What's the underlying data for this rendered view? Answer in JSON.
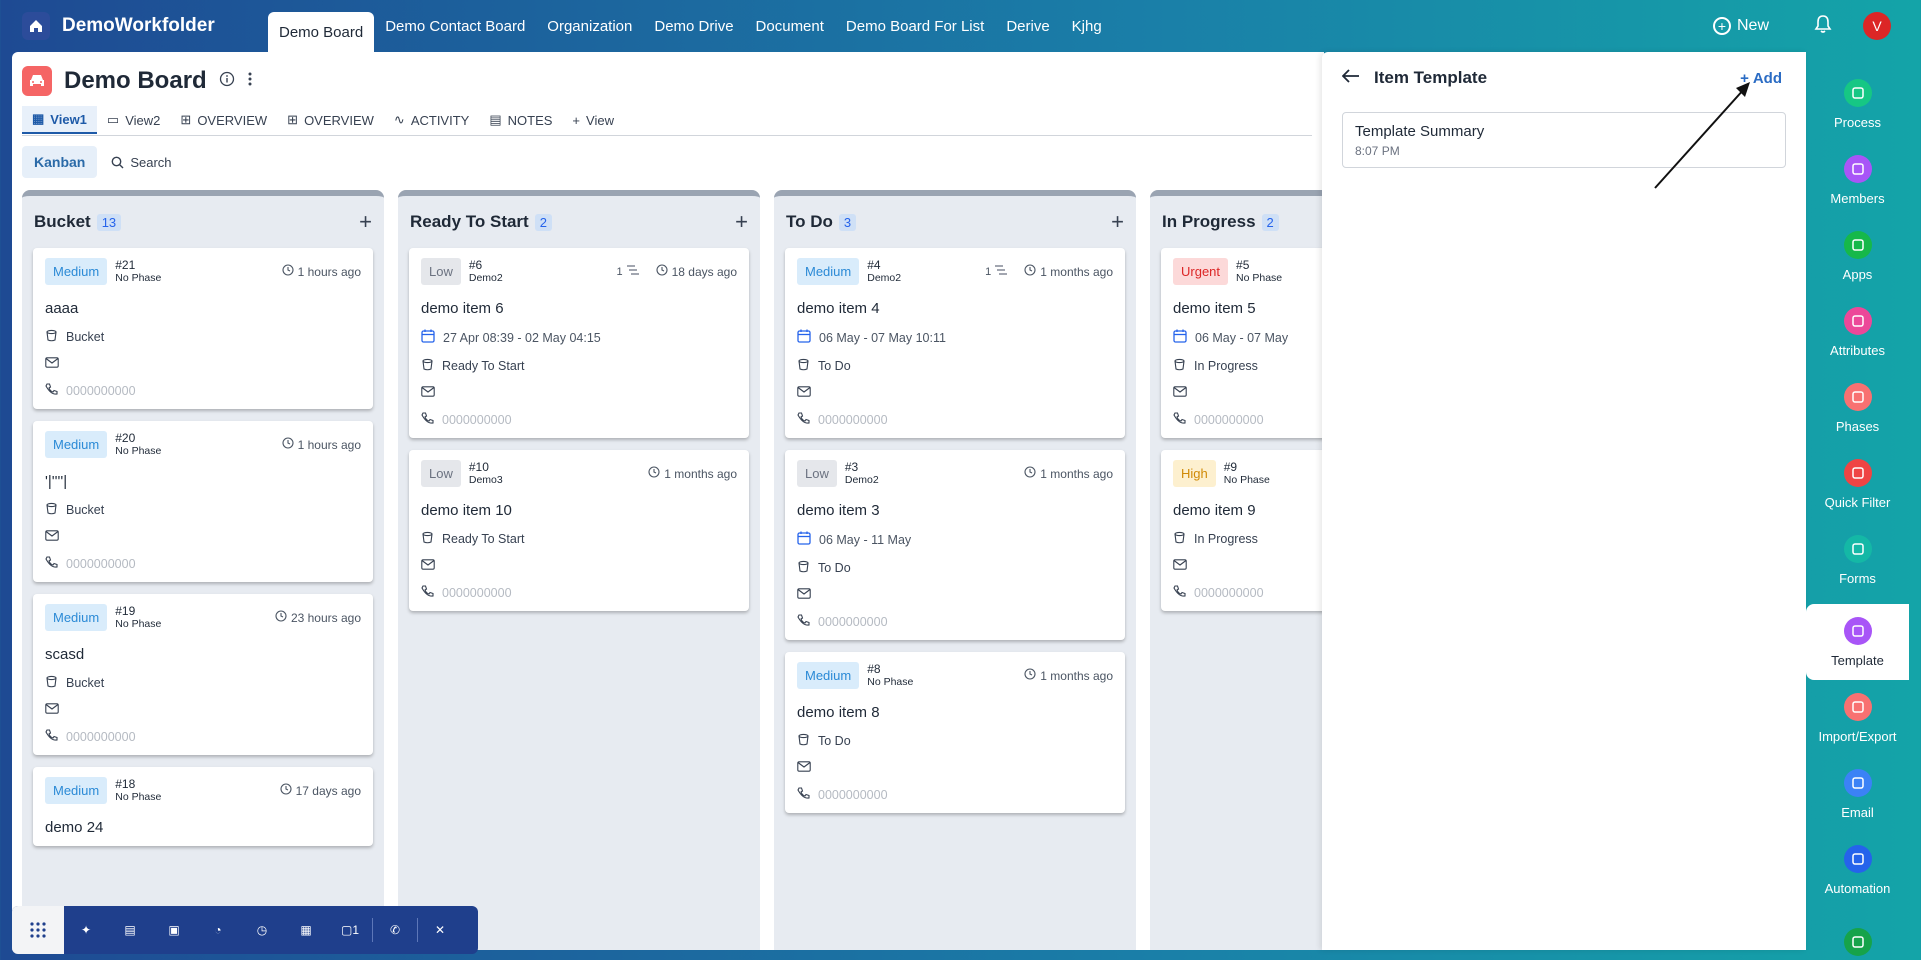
{
  "app": {
    "brand": "DemoWorkfolder",
    "nav_tabs": [
      "Demo Board",
      "Demo Contact Board",
      "Organization",
      "Demo Drive",
      "Document",
      "Demo Board For List",
      "Derive",
      "Kjhg"
    ],
    "new_label": "New",
    "avatar_initial": "V"
  },
  "board": {
    "title": "Demo Board",
    "view_tabs": [
      "View1",
      "View2",
      "OVERVIEW",
      "OVERVIEW",
      "ACTIVITY",
      "NOTES",
      "View"
    ],
    "kanban_label": "Kanban",
    "search_label": "Search"
  },
  "columns": [
    {
      "title": "Bucket",
      "count": "13",
      "cards": [
        {
          "priority": "Medium",
          "number": "#21",
          "phase": "No Phase",
          "time": "1 hours ago",
          "title": "aaaa",
          "bucket": "Bucket",
          "phone": "0000000000"
        },
        {
          "priority": "Medium",
          "number": "#20",
          "phase": "No Phase",
          "time": "1 hours ago",
          "title": "'|''''|",
          "bucket": "Bucket",
          "phone": "0000000000"
        },
        {
          "priority": "Medium",
          "number": "#19",
          "phase": "No Phase",
          "time": "23 hours ago",
          "title": "scasd",
          "bucket": "Bucket",
          "phone": "0000000000"
        },
        {
          "priority": "Medium",
          "number": "#18",
          "phase": "No Phase",
          "time": "17 days ago",
          "title": "demo 24"
        }
      ]
    },
    {
      "title": "Ready To Start",
      "count": "2",
      "cards": [
        {
          "priority": "Low",
          "number": "#6",
          "phase": "Demo2",
          "sub_count": "1",
          "time": "18 days ago",
          "title": "demo item 6",
          "dates": "27 Apr 08:39  -  02 May 04:15",
          "bucket": "Ready To Start",
          "phone": "0000000000"
        },
        {
          "priority": "Low",
          "number": "#10",
          "phase": "Demo3",
          "time": "1 months ago",
          "title": "demo item 10",
          "bucket": "Ready To Start",
          "phone": "0000000000"
        }
      ]
    },
    {
      "title": "To Do",
      "count": "3",
      "cards": [
        {
          "priority": "Medium",
          "number": "#4",
          "phase": "Demo2",
          "sub_count": "1",
          "time": "1 months ago",
          "title": "demo item 4",
          "dates": "06 May  -  07 May 10:11",
          "bucket": "To Do",
          "phone": "0000000000"
        },
        {
          "priority": "Low",
          "number": "#3",
          "phase": "Demo2",
          "time": "1 months ago",
          "title": "demo item 3",
          "dates": "06 May  -  11 May",
          "bucket": "To Do",
          "phone": "0000000000"
        },
        {
          "priority": "Medium",
          "number": "#8",
          "phase": "No Phase",
          "time": "1 months ago",
          "title": "demo item 8",
          "bucket": "To Do",
          "phone": "0000000000"
        }
      ]
    },
    {
      "title": "In Progress",
      "count": "2",
      "cards": [
        {
          "priority": "Urgent",
          "number": "#5",
          "phase": "No Phase",
          "title": "demo item 5",
          "dates": "06 May  -  07 May",
          "bucket": "In Progress",
          "phone": "0000000000"
        },
        {
          "priority": "High",
          "number": "#9",
          "phase": "No Phase",
          "title": "demo item 9",
          "bucket": "In Progress",
          "phone": "0000000000"
        }
      ]
    }
  ],
  "panel": {
    "title": "Item Template",
    "add_label": "Add",
    "template": {
      "name": "Template Summary",
      "time": "8:07 PM"
    }
  },
  "rightbar": [
    {
      "label": "Process",
      "icon": "process-icon",
      "color": "#16c784"
    },
    {
      "label": "Members",
      "icon": "members-icon",
      "color": "#a855f7"
    },
    {
      "label": "Apps",
      "icon": "apps-icon",
      "color": "#16b84a"
    },
    {
      "label": "Attributes",
      "icon": "attributes-icon",
      "color": "#ec4899"
    },
    {
      "label": "Phases",
      "icon": "phases-icon",
      "color": "#f87171"
    },
    {
      "label": "Quick Filter",
      "icon": "filter-icon",
      "color": "#ef4444"
    },
    {
      "label": "Forms",
      "icon": "forms-icon",
      "color": "#14b8a6"
    },
    {
      "label": "Template",
      "icon": "template-icon",
      "color": "#a855f7"
    },
    {
      "label": "Import/Export",
      "icon": "import-export-icon",
      "color": "#f87171"
    },
    {
      "label": "Email",
      "icon": "email-icon",
      "color": "#3b82f6"
    },
    {
      "label": "Automation",
      "icon": "automation-icon",
      "color": "#2563eb"
    },
    {
      "label": "",
      "icon": "rb-icon",
      "color": "#16a34a"
    }
  ],
  "bottombar": {
    "icons": [
      "apps-grid-icon",
      "sparkle-icon",
      "notes-icon",
      "card-icon",
      "gauge-icon",
      "timer-icon",
      "calendar-icon",
      "chat-icon",
      "phone-icon",
      "pin-off-icon"
    ],
    "chat_count": "1"
  }
}
